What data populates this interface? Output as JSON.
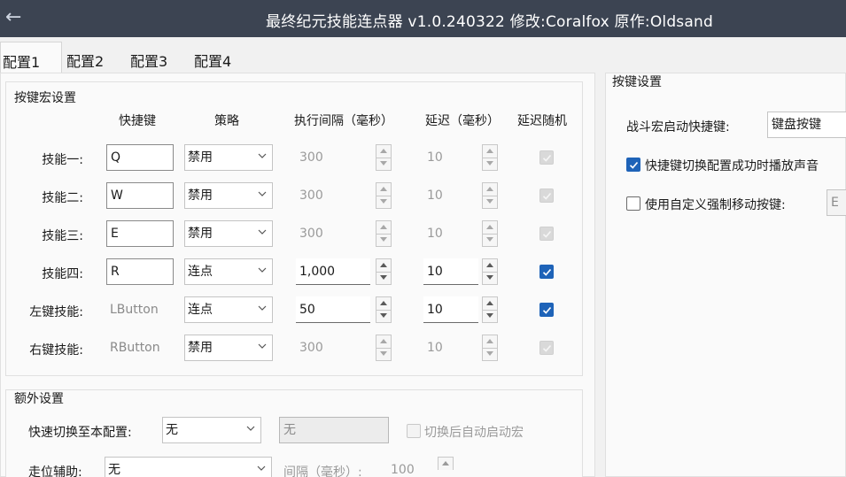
{
  "window": {
    "title": "最终纪元技能连点器 v1.0.240322  修改:Coralfox 原作:Oldsand",
    "back_icon": "←"
  },
  "tabs": [
    {
      "label": "配置1",
      "active": true
    },
    {
      "label": "配置2",
      "active": false
    },
    {
      "label": "配置3",
      "active": false
    },
    {
      "label": "配置4",
      "active": false
    }
  ],
  "macro": {
    "group_title": "按键宏设置",
    "headers": {
      "hotkey": "快捷键",
      "strategy": "策略",
      "interval": "执行间隔（毫秒）",
      "delay": "延迟（毫秒）",
      "random": "延迟随机"
    },
    "rows": [
      {
        "label": "技能一:",
        "hotkey": "Q",
        "strategy": "禁用",
        "interval": "300",
        "delay": "10",
        "enabled": false,
        "random": true
      },
      {
        "label": "技能二:",
        "hotkey": "W",
        "strategy": "禁用",
        "interval": "300",
        "delay": "10",
        "enabled": false,
        "random": true
      },
      {
        "label": "技能三:",
        "hotkey": "E",
        "strategy": "禁用",
        "interval": "300",
        "delay": "10",
        "enabled": false,
        "random": true
      },
      {
        "label": "技能四:",
        "hotkey": "R",
        "strategy": "连点",
        "interval": "1,000",
        "delay": "10",
        "enabled": true,
        "random": true
      },
      {
        "label": "左键技能:",
        "hotkey": "LButton",
        "strategy": "连点",
        "interval": "50",
        "delay": "10",
        "enabled": true,
        "random": true
      },
      {
        "label": "右键技能:",
        "hotkey": "RButton",
        "strategy": "禁用",
        "interval": "300",
        "delay": "10",
        "enabled": false,
        "random": true
      }
    ]
  },
  "extra": {
    "group_title": "额外设置",
    "quick_switch_label": "快速切换至本配置:",
    "quick_switch_value": "无",
    "quick_switch_display": "无",
    "auto_start_label": "切换后自动启动宏",
    "move_assist_label": "走位辅助:",
    "move_assist_value": "无",
    "interval_label": "间隔（毫秒）:",
    "interval_value": "100"
  },
  "key_settings": {
    "group_title": "按键设置",
    "start_hotkey_label": "战斗宏启动快捷键:",
    "start_hotkey_value": "键盘按键",
    "sound_label": "快捷键切换配置成功时播放声音",
    "sound_checked": true,
    "custom_move_label": "使用自定义强制移动按键:",
    "custom_move_checked": false,
    "custom_move_value": "E"
  },
  "colors": {
    "titlebar": "#3c4452",
    "accent": "#1e63b8"
  }
}
